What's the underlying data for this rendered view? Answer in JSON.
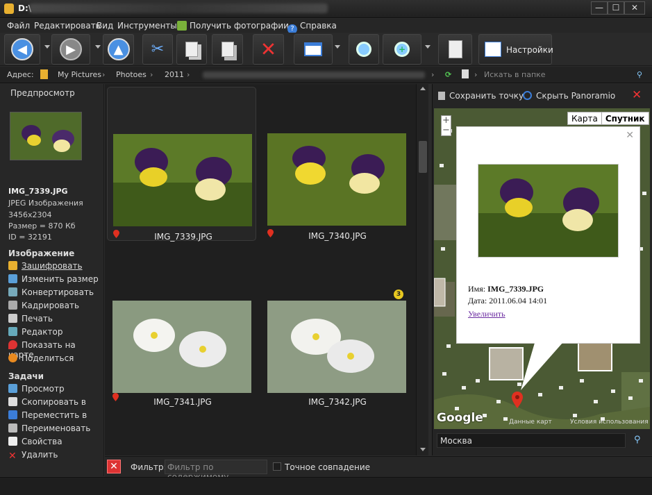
{
  "window": {
    "title": "D:\\",
    "buttons": [
      "—",
      "☐",
      "✕"
    ]
  },
  "menu": {
    "items": [
      "Файл",
      "Редактировать",
      "Вид",
      "Инструменты",
      "Получить фотографии",
      "Справка"
    ]
  },
  "toolbar": {
    "settings_label": "Настройки"
  },
  "address": {
    "label": "Адрес:",
    "crumbs": [
      "My Pictures",
      "Photoes",
      "2011"
    ],
    "search_placeholder": "Искать в папке"
  },
  "left": {
    "preview_title": "Предпросмотр",
    "file_name": "IMG_7339.JPG",
    "file_type": "JPEG Изображения",
    "dimensions": "3456x2304",
    "size": "Размер = 870 Кб",
    "id": "ID = 32191",
    "image_section": "Изображение",
    "image_actions": [
      "Зашифровать",
      "Изменить размер",
      "Конвертировать",
      "Кадрировать",
      "Печать",
      "Редактор",
      "Показать на карте",
      "Поделиться"
    ],
    "tasks_section": "Задачи",
    "task_actions": [
      "Просмотр",
      "Скопировать в",
      "Переместить в",
      "Переименовать",
      "Свойства",
      "Удалить"
    ]
  },
  "grid": {
    "items": [
      {
        "name": "IMG_7339.JPG"
      },
      {
        "name": "IMG_7340.JPG"
      },
      {
        "name": "IMG_7341.JPG"
      },
      {
        "name": "IMG_7342.JPG"
      }
    ],
    "badge": "3"
  },
  "map": {
    "save_point": "Сохранить точку",
    "hide_panoramio": "Скрыть Panoramio",
    "tab_map": "Карта",
    "tab_satellite": "Спутник",
    "popup_name_label": "Имя:",
    "popup_name": "IMG_7339.JPG",
    "popup_date_label": "Дата:",
    "popup_date": "2011.06.04 14:01",
    "popup_zoom": "Увеличить",
    "google": "Google",
    "attribution": "Данные карт",
    "terms": "Условия использования",
    "search_value": "Москва"
  },
  "filter": {
    "label": "Фильтр:",
    "placeholder": "Фильтр по содержимому",
    "exact_match": "Точное совпадение"
  }
}
